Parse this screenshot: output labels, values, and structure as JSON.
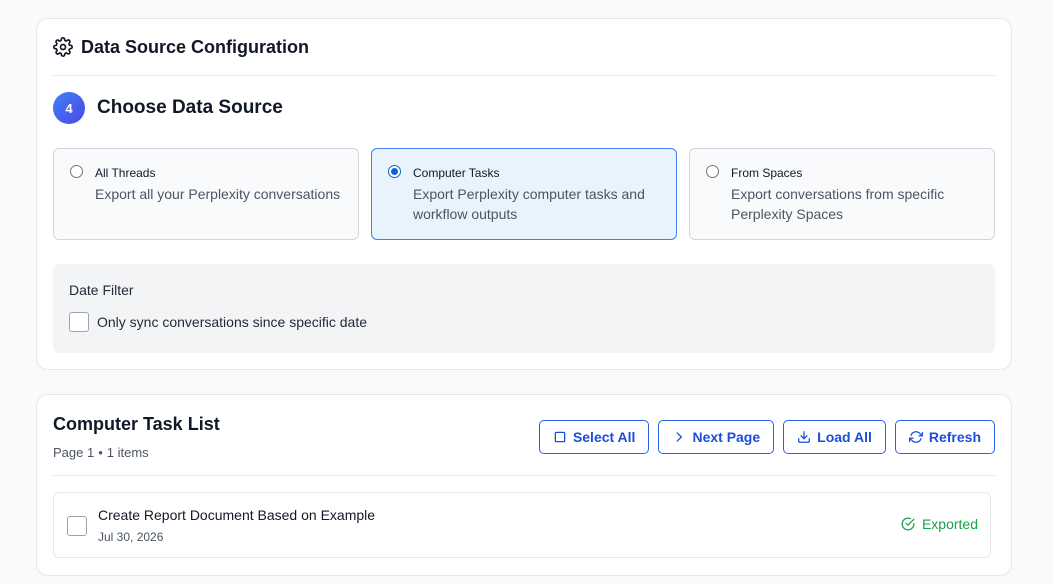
{
  "config": {
    "title": "Data Source Configuration",
    "step_number": "4",
    "step_title": "Choose Data Source",
    "options": [
      {
        "title": "All Threads",
        "description": "Export all your Perplexity conversations",
        "selected": false
      },
      {
        "title": "Computer Tasks",
        "description": "Export Perplexity computer tasks and workflow outputs",
        "selected": true
      },
      {
        "title": "From Spaces",
        "description": "Export conversations from specific Perplexity Spaces",
        "selected": false
      }
    ],
    "date_filter": {
      "title": "Date Filter",
      "checkbox_label": "Only sync conversations since specific date",
      "checked": false
    }
  },
  "list": {
    "title": "Computer Task List",
    "page_label": "Page 1",
    "items_label": "1 items",
    "buttons": {
      "select_all": "Select All",
      "next_page": "Next Page",
      "load_all": "Load All",
      "refresh": "Refresh"
    },
    "tasks": [
      {
        "title": "Create Report Document Based on Example",
        "date": "Jul 30, 2026",
        "status": "Exported"
      }
    ]
  },
  "colors": {
    "accent": "#2563eb",
    "selected_bg": "#e8f3fd",
    "status_success": "#16a34a"
  },
  "icons": [
    "gear-icon",
    "square-icon",
    "chevron-right-icon",
    "download-icon",
    "refresh-icon",
    "check-circle-icon"
  ]
}
